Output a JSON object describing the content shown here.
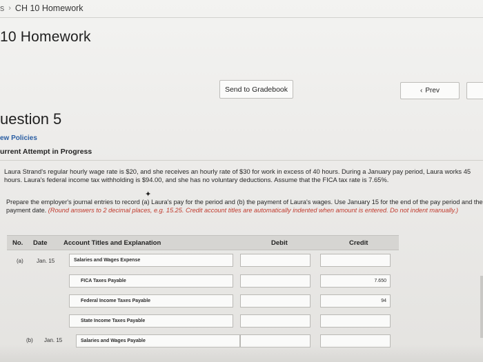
{
  "breadcrumb": {
    "prev": "s",
    "separator": "›",
    "current": "CH 10 Homework"
  },
  "page_title": "10 Homework",
  "buttons": {
    "send_to_gradebook": "Send to Gradebook",
    "prev_icon": "‹",
    "prev": "Prev"
  },
  "question": {
    "title": "uestion 5",
    "policies_link": "ew Policies",
    "attempt_status": "urrent Attempt in Progress"
  },
  "problem_text": "Laura Strand's regular hourly wage rate is $20, and she receives an hourly rate of $30 for work in excess of 40 hours. During a January pay period, Laura works 45 hours. Laura's federal income tax withholding is $94.00, and she has no voluntary deductions. Assume that the FICA tax rate is 7.65%.",
  "instructions": {
    "text": "Prepare the employer's journal entries to record (a) Laura's pay for the period and (b) the payment of Laura's wages. Use January 15 for the end of the pay period and the payment date.",
    "note": "(Round answers to 2 decimal places, e.g. 15.25. Credit account titles are automatically indented when amount is entered. Do not indent manually.)"
  },
  "table": {
    "headers": {
      "no": "No.",
      "date": "Date",
      "account": "Account Titles and Explanation",
      "debit": "Debit",
      "credit": "Credit"
    },
    "entries": [
      {
        "no": "(a)",
        "date": "Jan. 15",
        "account": "Salaries and Wages Expense",
        "debit": "",
        "credit": ""
      },
      {
        "no": "",
        "date": "",
        "account": "FICA Taxes Payable",
        "debit": "",
        "credit": "7.650"
      },
      {
        "no": "",
        "date": "",
        "account": "Federal Income Taxes Payable",
        "debit": "",
        "credit": "94"
      },
      {
        "no": "",
        "date": "",
        "account": "State Income Taxes Payable",
        "debit": "",
        "credit": ""
      },
      {
        "no": "(b)",
        "date": "Jan. 15",
        "account": "Salaries and Wages Payable",
        "debit": "",
        "credit": ""
      }
    ]
  }
}
